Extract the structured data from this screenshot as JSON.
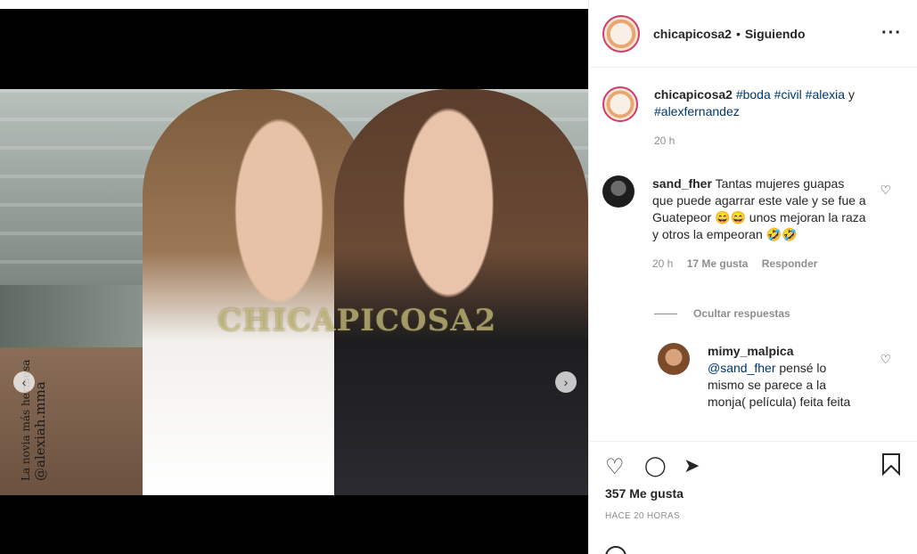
{
  "post": {
    "username": "chicapicosa2",
    "separator": "•",
    "follow_status": "Siguiendo",
    "more_icon": "more-options-icon",
    "photo": {
      "watermark": "CHICAPICOSA2",
      "vertical_caption": "La novia más hermosa",
      "vertical_handle": "@alexiah.mma"
    }
  },
  "caption": {
    "username": "chicapicosa2",
    "hashtags": [
      "#boda",
      "#civil",
      "#alexia",
      "#alexfernandez"
    ],
    "joiner": "y",
    "time": "20 h"
  },
  "comments": [
    {
      "username": "sand_fher",
      "text": "Tantas mujeres guapas que puede agarrar este vale y se fue a Guatepeor 😄😄 unos mejoran la raza y otros la empeoran 🤣🤣",
      "time": "20 h",
      "likes": "17 Me gusta",
      "reply_label": "Responder"
    }
  ],
  "replies_toggle": "Ocultar respuestas",
  "replies": [
    {
      "username": "mimy_malpica",
      "mention": "@sand_fher",
      "text": "pensé lo mismo se parece a la monja( película) feita feita"
    }
  ],
  "actions": {
    "likes_count": "357 Me gusta",
    "time_ago": "HACE 20 HORAS"
  }
}
